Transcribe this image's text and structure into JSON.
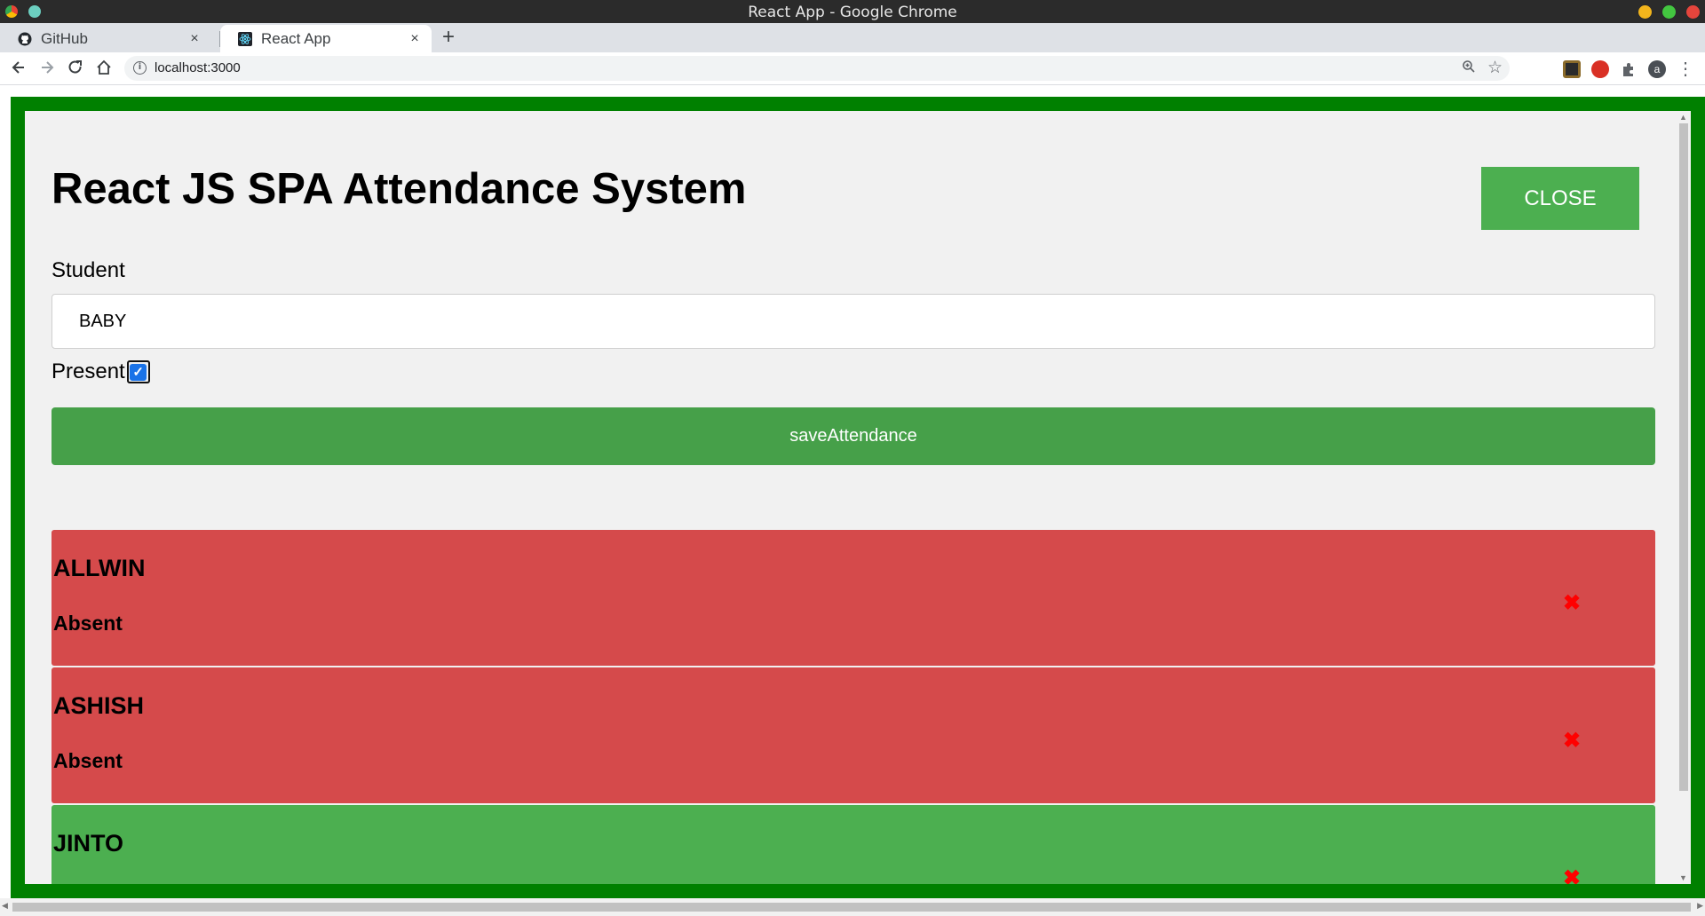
{
  "window": {
    "title": "React App - Google Chrome"
  },
  "tabs": [
    {
      "label": "GitHub",
      "close": "×",
      "icon": "github-icon"
    },
    {
      "label": "React App",
      "close": "×",
      "icon": "react-icon"
    }
  ],
  "new_tab": "+",
  "address_bar": {
    "url": "localhost:3000",
    "info": "i"
  },
  "profile_initial": "a",
  "app": {
    "heading": "React JS SPA Attendance System",
    "close_label": "CLOSE",
    "student_label": "Student",
    "student_value": "BABY",
    "present_label": "Present",
    "present_checked": true,
    "save_label": "saveAttendance"
  },
  "records": [
    {
      "name": "ALLWIN",
      "status": "Absent",
      "delete": "✖"
    },
    {
      "name": "ASHISH",
      "status": "Absent",
      "delete": "✖"
    },
    {
      "name": "JINTO",
      "status": "",
      "delete": "✖"
    }
  ],
  "colors": {
    "frame": "#008000",
    "absent": "#d54a4b",
    "present": "#4caf50",
    "save_button": "#46a049",
    "delete": "#ff0000"
  }
}
